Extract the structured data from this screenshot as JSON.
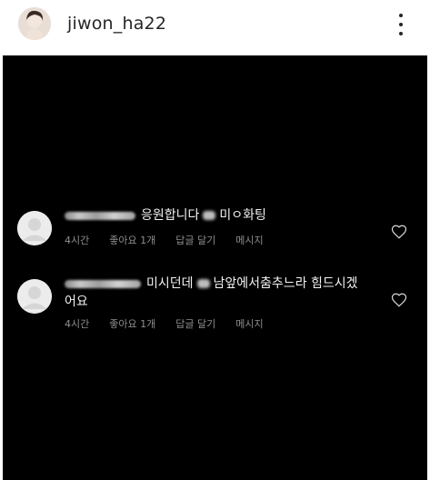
{
  "header": {
    "username": "jiwon_ha22"
  },
  "comments": [
    {
      "text_part1": "응원합니다",
      "text_part2": "미ㅇ화팅",
      "time": "4시간",
      "likes": "좋아요 1개",
      "reply": "답글 달기",
      "message": "메시지"
    },
    {
      "text_part1": "미시던데",
      "text_part2": "남앞에서춤추느라 힘드시겠",
      "text_line2": "어요",
      "time": "4시간",
      "likes": "좋아요 1개",
      "reply": "답글 달기",
      "message": "메시지"
    }
  ],
  "icons": {
    "more": "more-vertical-icon",
    "like": "heart-outline-icon"
  }
}
